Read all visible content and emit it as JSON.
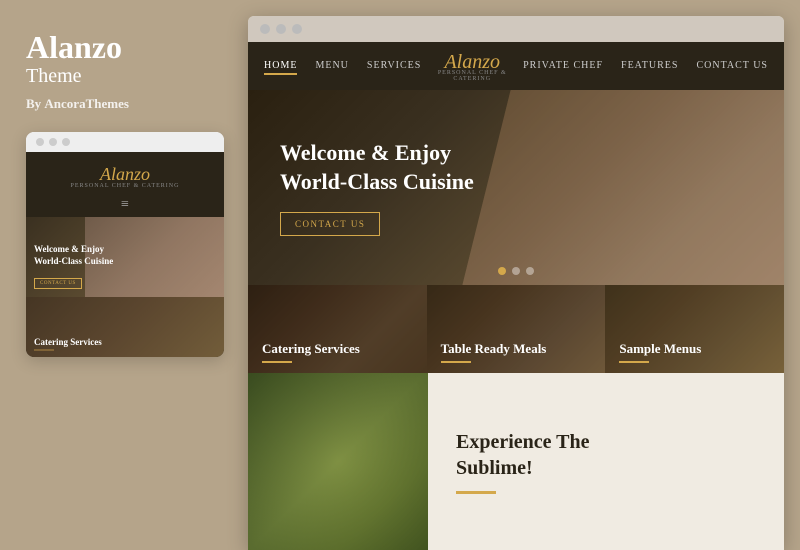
{
  "left": {
    "title": "Alanzo",
    "subtitle": "Theme",
    "by_label": "By",
    "by_author": "AncoraThemes",
    "mobile_dots": [
      "●",
      "●",
      "●"
    ],
    "mobile_logo": "Alanzo",
    "mobile_logo_sub": "Personal Chef & Catering",
    "mobile_hero_title": "Welcome & Enjoy\nWorld-Class Cuisine",
    "mobile_hero_btn": "CONTACT US",
    "mobile_catering_label": "Catering Services"
  },
  "browser": {
    "dots": [
      "●",
      "●",
      "●"
    ],
    "nav": {
      "links_left": [
        "HOME",
        "MENU",
        "SERVICES"
      ],
      "logo": "Alanzo",
      "logo_sub": "Personal Chef & Catering",
      "links_right": [
        "PRIVATE CHEF",
        "FEATURES",
        "CONTACT US"
      ]
    },
    "hero": {
      "title": "Welcome & Enjoy\nWorld-Class Cuisine",
      "btn": "CONTACT US",
      "dots": [
        true,
        false,
        false
      ]
    },
    "services": [
      {
        "label": "Catering Services"
      },
      {
        "label": "Table Ready Meals"
      },
      {
        "label": "Sample Menus"
      }
    ],
    "bottom": {
      "heading": "Experience The\nSublime!"
    }
  }
}
